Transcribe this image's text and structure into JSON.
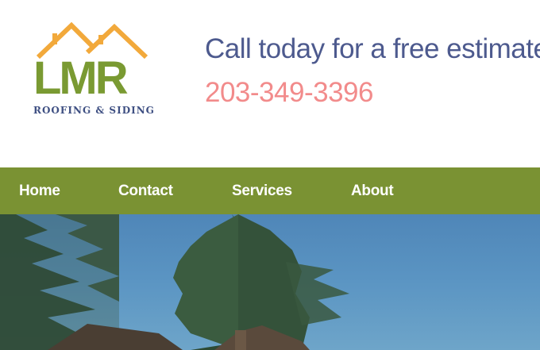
{
  "logo": {
    "letters": "LMR",
    "subtitle": "ROOFING & SIDING"
  },
  "header": {
    "tagline": "Call today for a free estimate!",
    "phone": "203-349-3396"
  },
  "nav": {
    "items": [
      {
        "label": "Home"
      },
      {
        "label": "Contact"
      },
      {
        "label": "Services"
      },
      {
        "label": "About"
      }
    ]
  },
  "colors": {
    "brand_green": "#7a9233",
    "logo_orange": "#f2a93b",
    "navy": "#4d5a8e",
    "phone_pink": "#f28b8b"
  }
}
